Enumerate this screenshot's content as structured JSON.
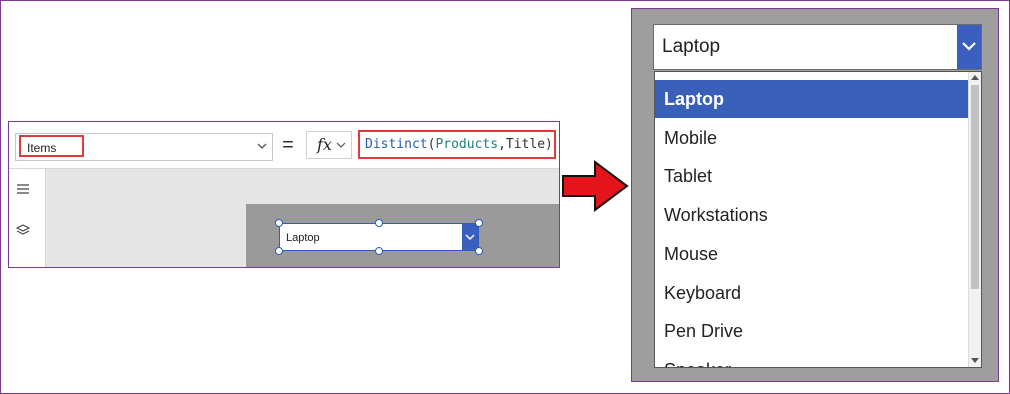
{
  "left": {
    "property": "Items",
    "equals": "=",
    "fx": "fx",
    "formula": {
      "fn": "Distinct",
      "open": "(",
      "arg1": "Products",
      "comma": ",",
      "arg2": "Title",
      "close": ")"
    },
    "control_value": "Laptop",
    "rail_icons": [
      "hamburger-icon",
      "layers-icon"
    ]
  },
  "arrow": {
    "color": "#e3141b"
  },
  "right": {
    "selected_value": "Laptop",
    "items": [
      "Laptop",
      "Mobile",
      "Tablet",
      "Workstations",
      "Mouse",
      "Keyboard",
      "Pen Drive",
      "Speaker"
    ],
    "accent": "#3a5fb8"
  }
}
